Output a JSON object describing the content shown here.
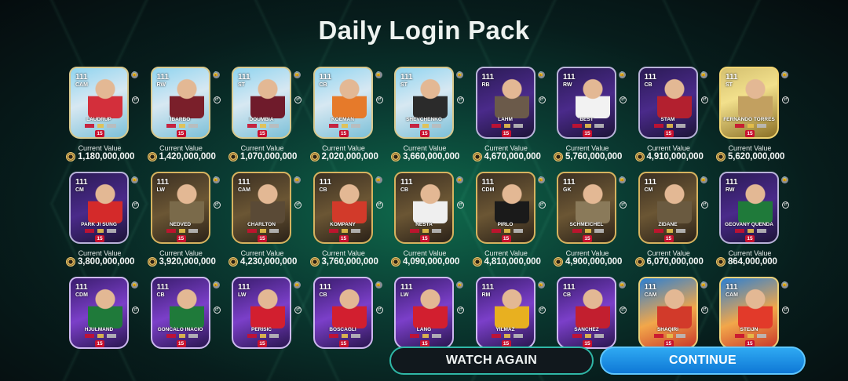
{
  "title": "Daily Login Pack",
  "value_label": "Current Value",
  "cards": [
    {
      "name": "LAUDRUP",
      "rating": "111",
      "position": "CAM",
      "value": "1,180,000,000",
      "theme": "toty",
      "shirt": "#d32f3b"
    },
    {
      "name": "IBARBO",
      "rating": "111",
      "position": "RW",
      "value": "1,420,000,000",
      "theme": "toty",
      "shirt": "#7a1f2a"
    },
    {
      "name": "DOUMBIA",
      "rating": "111",
      "position": "ST",
      "value": "1,070,000,000",
      "theme": "toty",
      "shirt": "#6f1b2b"
    },
    {
      "name": "KOEMAN",
      "rating": "111",
      "position": "CB",
      "value": "2,020,000,000",
      "theme": "toty",
      "shirt": "#e67a2a"
    },
    {
      "name": "SHEVCHENKO",
      "rating": "111",
      "position": "ST",
      "value": "3,660,000,000",
      "theme": "toty",
      "shirt": "#2b2b2b"
    },
    {
      "name": "LAHM",
      "rating": "111",
      "position": "RB",
      "value": "4,670,000,000",
      "theme": "purple",
      "shirt": "#6b5a4a"
    },
    {
      "name": "BEST",
      "rating": "111",
      "position": "RW",
      "value": "5,760,000,000",
      "theme": "purple",
      "shirt": "#f2f2f2"
    },
    {
      "name": "STAM",
      "rating": "111",
      "position": "CB",
      "value": "4,910,000,000",
      "theme": "purple",
      "shirt": "#b3202f"
    },
    {
      "name": "FERNANDO TORRES",
      "rating": "111",
      "position": "ST",
      "value": "5,620,000,000",
      "theme": "gold",
      "shirt": "#c2a060"
    },
    {
      "name": "PARK JI SUNG",
      "rating": "111",
      "position": "CM",
      "value": "3,800,000,000",
      "theme": "purple",
      "shirt": "#d42a2a"
    },
    {
      "name": "NEDVED",
      "rating": "111",
      "position": "LW",
      "value": "3,920,000,000",
      "theme": "icon",
      "shirt": "#7a6a4a"
    },
    {
      "name": "CHARLTON",
      "rating": "111",
      "position": "CAM",
      "value": "4,230,000,000",
      "theme": "icon",
      "shirt": "#5a4a36"
    },
    {
      "name": "KOMPANY",
      "rating": "111",
      "position": "CB",
      "value": "3,760,000,000",
      "theme": "icon",
      "shirt": "#d23a2a"
    },
    {
      "name": "NESTA",
      "rating": "111",
      "position": "CB",
      "value": "4,090,000,000",
      "theme": "icon",
      "shirt": "#efefef"
    },
    {
      "name": "PIRLO",
      "rating": "111",
      "position": "CDM",
      "value": "4,810,000,000",
      "theme": "icon",
      "shirt": "#1a1a1a"
    },
    {
      "name": "SCHMEICHEL",
      "rating": "111",
      "position": "GK",
      "value": "4,900,000,000",
      "theme": "icon",
      "shirt": "#8a7a5a"
    },
    {
      "name": "ZIDANE",
      "rating": "111",
      "position": "CM",
      "value": "6,070,000,000",
      "theme": "icon",
      "shirt": "#6a5a40"
    },
    {
      "name": "GEOVANY QUENDA",
      "rating": "111",
      "position": "RW",
      "value": "864,000,000",
      "theme": "purple",
      "shirt": "#1f7a3a"
    },
    {
      "name": "HJULMAND",
      "rating": "111",
      "position": "CDM",
      "value": "",
      "theme": "ucl",
      "shirt": "#1f7a3a"
    },
    {
      "name": "GONCALO INACIO",
      "rating": "111",
      "position": "CB",
      "value": "",
      "theme": "ucl",
      "shirt": "#1f7a3a"
    },
    {
      "name": "PERISIC",
      "rating": "111",
      "position": "LW",
      "value": "",
      "theme": "ucl",
      "shirt": "#d21f2f"
    },
    {
      "name": "BOSCAGLI",
      "rating": "111",
      "position": "CB",
      "value": "",
      "theme": "ucl",
      "shirt": "#d21f2f"
    },
    {
      "name": "LANG",
      "rating": "111",
      "position": "LW",
      "value": "",
      "theme": "ucl",
      "shirt": "#d21f2f"
    },
    {
      "name": "YILMAZ",
      "rating": "111",
      "position": "RM",
      "value": "",
      "theme": "ucl",
      "shirt": "#e8b020"
    },
    {
      "name": "SANCHEZ",
      "rating": "111",
      "position": "CB",
      "value": "",
      "theme": "ucl",
      "shirt": "#c21f2f"
    },
    {
      "name": "SHAQIRI",
      "rating": "111",
      "position": "CAM",
      "value": "",
      "theme": "fire",
      "shirt": "#d23a2a"
    },
    {
      "name": "STEIJN",
      "rating": "111",
      "position": "CAM",
      "value": "",
      "theme": "fire",
      "shirt": "#e23a2a"
    }
  ],
  "card_badge": "15",
  "buttons": {
    "watch_again": "WATCH AGAIN",
    "continue": "CONTINUE"
  },
  "colors": {
    "continue_button": "#1e90e8",
    "watch_border": "#2fb7a6",
    "accent_gold": "#d9b25a"
  }
}
